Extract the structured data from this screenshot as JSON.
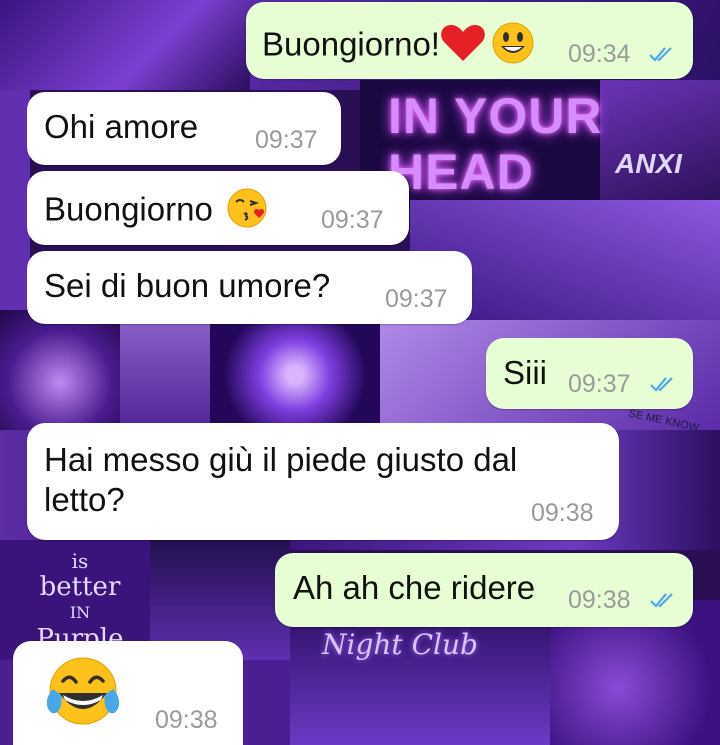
{
  "messages": [
    {
      "direction": "outgoing",
      "text": "Buongiorno!",
      "emoji": [
        "heart",
        "smiley"
      ],
      "time": "09:34",
      "status": "read"
    },
    {
      "direction": "incoming",
      "text": "Ohi amore",
      "time": "09:37"
    },
    {
      "direction": "incoming",
      "text": "Buongiorno",
      "emoji": [
        "kissing-heart"
      ],
      "time": "09:37"
    },
    {
      "direction": "incoming",
      "text": "Sei di buon umore?",
      "time": "09:37"
    },
    {
      "direction": "outgoing",
      "text": "Siii",
      "time": "09:37",
      "status": "read"
    },
    {
      "direction": "incoming",
      "text_lines": [
        "Hai messo giù il piede giusto dal",
        "letto?"
      ],
      "time": "09:38"
    },
    {
      "direction": "outgoing",
      "text": "Ah ah che ridere",
      "time": "09:38",
      "status": "read"
    },
    {
      "direction": "incoming",
      "text": "",
      "emoji": [
        "tears-of-joy"
      ],
      "time": "09:38"
    }
  ],
  "wallpaper": {
    "neon_lines": [
      "IN YOUR",
      "HEAD"
    ],
    "anx_text": "ANXI",
    "better_lines": [
      "is",
      "better",
      "IN",
      "Purple"
    ],
    "nightclub_text": "Night Club",
    "scribble": "SE ME KNOW"
  },
  "colors": {
    "incoming_bubble": "#ffffff",
    "outgoing_bubble": "#e7fdd4",
    "read_ticks": "#4fa9e6",
    "timestamp": "#9a9a9a"
  }
}
